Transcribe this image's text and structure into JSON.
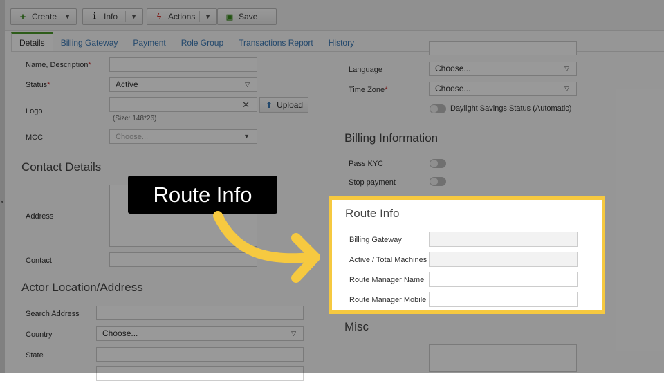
{
  "toolbar": {
    "create_label": "Create",
    "info_label": "Info",
    "actions_label": "Actions",
    "save_label": "Save"
  },
  "tabs": [
    {
      "label": "Details"
    },
    {
      "label": "Billing Gateway"
    },
    {
      "label": "Payment"
    },
    {
      "label": "Role Group"
    },
    {
      "label": "Transactions Report"
    },
    {
      "label": "History"
    }
  ],
  "form_left": {
    "name_label": "Name, Description",
    "status_label": "Status",
    "status_value": "Active",
    "logo_label": "Logo",
    "logo_hint": "(Size: 148*26)",
    "upload_label": "Upload",
    "mcc_label": "MCC",
    "mcc_placeholder": "Choose...",
    "contact_section": "Contact Details",
    "address_label": "Address",
    "contact_label": "Contact",
    "location_section": "Actor Location/Address",
    "search_address_label": "Search Address",
    "country_label": "Country",
    "country_value": "Choose...",
    "state_label": "State"
  },
  "form_right": {
    "language_label": "Language",
    "language_value": "Choose...",
    "timezone_label": "Time Zone",
    "timezone_value": "Choose...",
    "dst_label": "Daylight Savings Status (Automatic)",
    "billing_section": "Billing Information",
    "pass_kyc_label": "Pass KYC",
    "stop_payment_label": "Stop payment",
    "misc_section": "Misc"
  },
  "route_info": {
    "title": "Route Info",
    "fields": [
      {
        "label": "Billing Gateway"
      },
      {
        "label": "Active / Total Machines"
      },
      {
        "label": "Route Manager Name"
      },
      {
        "label": "Route Manager Mobile"
      }
    ]
  },
  "callout": {
    "text": "Route Info",
    "arrow_color": "#f6c940",
    "highlight_color": "#f6c940"
  },
  "colors": {
    "tab_link": "#3b79b5",
    "active_tab_border": "#4c9a2a",
    "required": "#cc3333"
  }
}
